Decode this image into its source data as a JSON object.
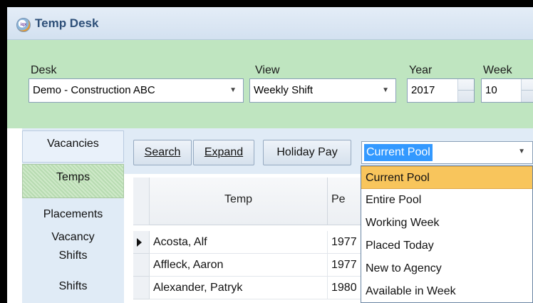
{
  "window": {
    "title": "Temp Desk",
    "icon": "iqx-logo-icon"
  },
  "filters": {
    "desk": {
      "label": "Desk",
      "value": "Demo - Construction ABC"
    },
    "view": {
      "label": "View",
      "value": "Weekly Shift"
    },
    "year": {
      "label": "Year",
      "value": "2017"
    },
    "week": {
      "label": "Week",
      "value": "10"
    }
  },
  "sidebar": {
    "items": [
      {
        "label": "Vacancies"
      },
      {
        "label": "Temps",
        "active": true
      },
      {
        "label": "Placements"
      },
      {
        "label": "Vacancy"
      },
      {
        "label": "Shifts"
      },
      {
        "label": "Shifts"
      }
    ]
  },
  "toolbar": {
    "search_label": "Search",
    "expand_label": "Expand",
    "holiday_pay_label": "Holiday Pay",
    "pool_select_value": "Current Pool"
  },
  "grid": {
    "columns": [
      "Temp",
      "Pe"
    ],
    "rows": [
      {
        "temp": "Acosta, Alf",
        "pe": "1977",
        "current": true
      },
      {
        "temp": "Affleck, Aaron",
        "pe": "1977"
      },
      {
        "temp": "Alexander, Patryk",
        "pe": "1980"
      }
    ]
  },
  "pool_dropdown": {
    "options": [
      "Current Pool",
      "Entire Pool",
      "Working Week",
      "Placed Today",
      "New to Agency",
      "Available in Week"
    ],
    "highlighted": "Current Pool"
  },
  "colors": {
    "accent": "#3399ff",
    "panel_green": "#bfe5c0",
    "highlight": "#f8c55c"
  }
}
